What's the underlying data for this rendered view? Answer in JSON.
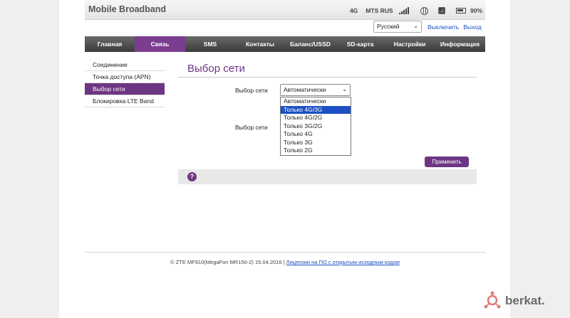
{
  "header": {
    "brand": "Mobile Broadband",
    "network_type": "4G",
    "operator": "MTS RUS",
    "battery": "90%",
    "icons": [
      "signal-icon",
      "globe-icon",
      "wifi-icon",
      "battery-icon"
    ]
  },
  "language": {
    "selected": "Русский"
  },
  "auth": {
    "logout": "Выключить",
    "exit": "Выход"
  },
  "nav": {
    "items": [
      {
        "label": "Главная"
      },
      {
        "label": "Связь"
      },
      {
        "label": "SMS"
      },
      {
        "label": "Контакты"
      },
      {
        "label": "Баланс/USSD"
      },
      {
        "label": "SD-карта"
      },
      {
        "label": "Настройки"
      },
      {
        "label": "Информация"
      }
    ],
    "active_index": 1
  },
  "sidebar": {
    "items": [
      {
        "label": "Соединение"
      },
      {
        "label": "Точка доступа (APN)"
      },
      {
        "label": "Выбор сети"
      },
      {
        "label": "Блокировка LTE Band"
      }
    ],
    "active_index": 2
  },
  "main": {
    "title": "Выбор сети",
    "field1_label": "Выбор сети",
    "field1_value": "Автоматически",
    "field2_label": "Выбор сети",
    "dropdown_options": [
      "Автоматически",
      "Только 4G/3G",
      "Только 4G/2G",
      "Только 3G/2G",
      "Только 4G",
      "Только 3G",
      "Только 2G"
    ],
    "highlighted_option": 1,
    "apply_label": "Применить",
    "help_label": "?"
  },
  "footer": {
    "copyright": "© ZTE MF910(MegaFon MR150-2) 15.04.2016 |",
    "license_link": "Лицензии на ПО с открытым исходным кодом"
  },
  "watermark": {
    "text": "berkat."
  },
  "colors": {
    "accent": "#6d3683",
    "nav_dark": "#3a3a3a",
    "link": "#1a4fc0"
  }
}
